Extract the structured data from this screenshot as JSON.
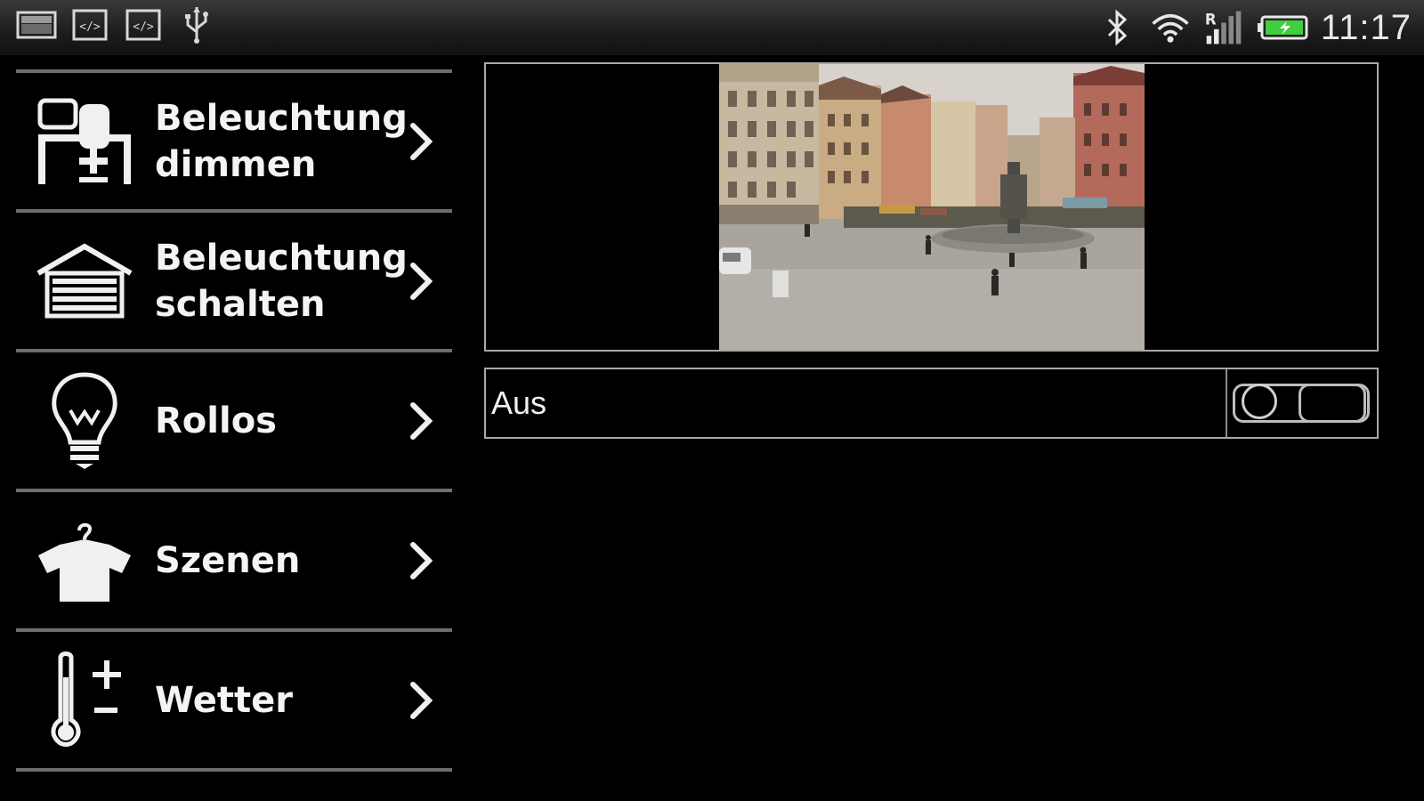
{
  "status_bar": {
    "time": "11:17",
    "left_icons": [
      "image-icon",
      "code-icon",
      "code-icon",
      "usb-icon"
    ],
    "right_icons": [
      "bluetooth-icon",
      "wifi-icon",
      "signal-roaming-icon",
      "battery-charging-icon"
    ],
    "roaming_letter": "R"
  },
  "menu": {
    "items": [
      {
        "label": "Beleuchtung\ndimmen",
        "icon": "desk-workstation-icon"
      },
      {
        "label": "Beleuchtung\nschalten",
        "icon": "garage-icon"
      },
      {
        "label": "Rollos",
        "icon": "lightbulb-icon"
      },
      {
        "label": "Szenen",
        "icon": "shirt-hanger-icon"
      },
      {
        "label": "Wetter",
        "icon": "thermometer-icon"
      }
    ]
  },
  "camera": {
    "description_icon": "webcam-town-square-image"
  },
  "switch": {
    "label": "Aus",
    "state": "off"
  },
  "colors": {
    "background": "#000000",
    "divider": "#6d6d6d",
    "border": "#a8a8a8",
    "battery": "#3fcf3f"
  }
}
